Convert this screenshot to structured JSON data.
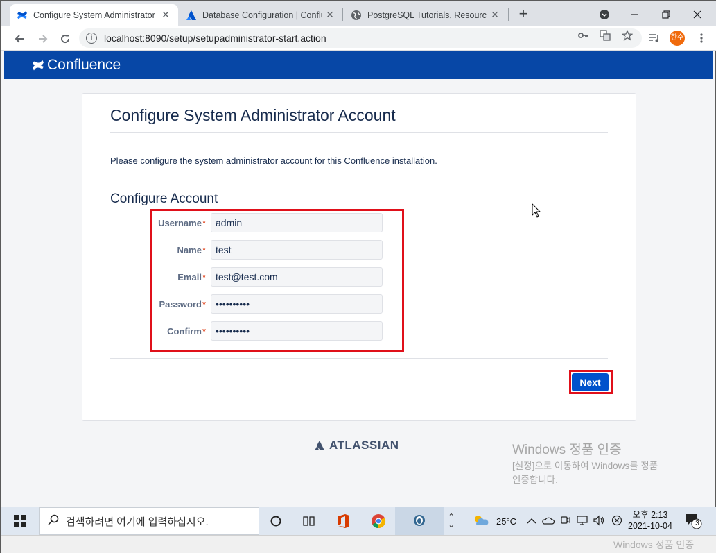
{
  "browser": {
    "tabs": [
      {
        "title": "Configure System Administrator",
        "active": true
      },
      {
        "title": "Database Configuration | Conflu",
        "active": false
      },
      {
        "title": "PostgreSQL Tutorials, Resources",
        "active": false
      }
    ],
    "new_tab": "+",
    "url": "localhost:8090/setup/setupadministrator-start.action",
    "avatar_label": "한수"
  },
  "header": {
    "app_name": "Confluence",
    "brand_color": "#0747a6"
  },
  "page": {
    "title": "Configure System Administrator Account",
    "description": "Please configure the system administrator account for this Confluence installation.",
    "section_title": "Configure Account",
    "fields": [
      {
        "label": "Username",
        "required_mark": "*",
        "value": "admin",
        "type": "text"
      },
      {
        "label": "Name",
        "required_mark": "*",
        "value": "test",
        "type": "text"
      },
      {
        "label": "Email",
        "required_mark": "*",
        "value": "test@test.com",
        "type": "text"
      },
      {
        "label": "Password",
        "required_mark": "*",
        "value": "••••••••••",
        "type": "password"
      },
      {
        "label": "Confirm",
        "required_mark": "*",
        "value": "••••••••••",
        "type": "password"
      }
    ],
    "next_button": "Next",
    "footer_brand": "ATLASSIAN",
    "accent_color": "#0052cc",
    "highlight_color": "#e0101a"
  },
  "watermark": {
    "line1": "Windows 정품 인증",
    "line2": "[설정]으로 이동하여 Windows를 정품",
    "line3": "인증합니다."
  },
  "taskbar": {
    "search_placeholder": "검색하려면 여기에 입력하십시오.",
    "weather": "25°C",
    "time": "오후 2:13",
    "date": "2021-10-04",
    "notification_count": "3"
  }
}
